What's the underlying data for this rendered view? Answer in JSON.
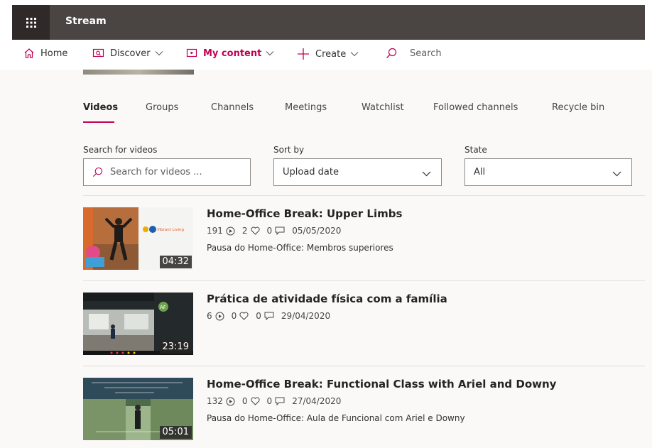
{
  "app": {
    "name": "Stream"
  },
  "nav": {
    "home": "Home",
    "discover": "Discover",
    "my_content": "My content",
    "create": "Create",
    "search": "Search"
  },
  "tabs": [
    "Videos",
    "Groups",
    "Channels",
    "Meetings",
    "Watchlist",
    "Followed channels",
    "Recycle bin"
  ],
  "filters": {
    "search_label": "Search for videos",
    "search_placeholder": "Search for videos ...",
    "sort_label": "Sort by",
    "sort_value": "Upload date",
    "state_label": "State",
    "state_value": "All"
  },
  "videos": [
    {
      "title": "Home-Office Break: Upper Limbs",
      "views": "191",
      "likes": "2",
      "comments": "0",
      "date": "05/05/2020",
      "description": "Pausa do Home-Office: Membros superiores",
      "duration": "04:32",
      "thumb_overlay": "Vibrant Living"
    },
    {
      "title": "Prática de atividade física com a família",
      "views": "6",
      "likes": "0",
      "comments": "0",
      "date": "29/04/2020",
      "description": "",
      "duration": "23:19",
      "thumb_overlay": "AF"
    },
    {
      "title": "Home-Office Break: Functional Class with Ariel and Downy",
      "views": "132",
      "likes": "0",
      "comments": "0",
      "date": "27/04/2020",
      "description": "Pausa do Home-Office: Aula de Funcional com Ariel e Downy",
      "duration": "05:01",
      "thumb_overlay": ""
    }
  ],
  "colors": {
    "accent": "#c30052",
    "topbar": "#4a4543",
    "waffle_bg": "#2f2a29",
    "content_bg": "#faf9f8"
  },
  "icons": {
    "waffle": "app-launcher-icon",
    "home": "home-icon",
    "discover": "discover-icon",
    "my_content": "my-content-icon",
    "create": "plus-icon",
    "search": "search-icon",
    "views": "play-circle-icon",
    "likes": "heart-icon",
    "comments": "comment-icon"
  }
}
